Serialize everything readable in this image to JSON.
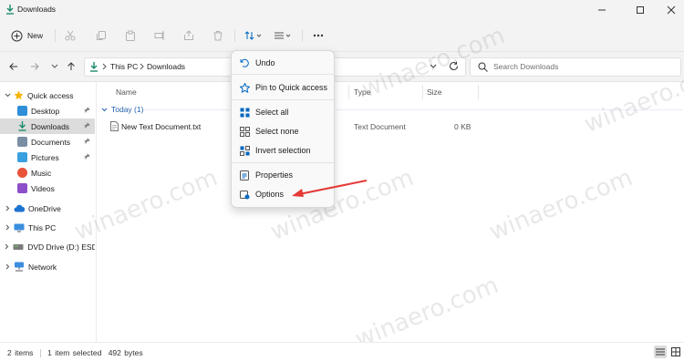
{
  "window": {
    "title": "Downloads"
  },
  "toolbar": {
    "new_label": "New",
    "icons": [
      "cut-icon",
      "copy-icon",
      "paste-icon",
      "rename-icon",
      "share-icon",
      "delete-icon",
      "sort-icon",
      "view-icon",
      "more-icon"
    ]
  },
  "address": {
    "crumbs": [
      "This PC",
      "Downloads"
    ],
    "search_placeholder": "Search Downloads"
  },
  "nav": {
    "items": [
      {
        "label": "Quick access",
        "icon": "star-icon"
      },
      {
        "label": "Desktop",
        "icon": "desktop-icon"
      },
      {
        "label": "Downloads",
        "icon": "downloads-icon"
      },
      {
        "label": "Documents",
        "icon": "documents-icon"
      },
      {
        "label": "Pictures",
        "icon": "pictures-icon"
      },
      {
        "label": "Music",
        "icon": "music-icon"
      },
      {
        "label": "Videos",
        "icon": "videos-icon"
      },
      {
        "label": "OneDrive",
        "icon": "cloud-icon"
      },
      {
        "label": "This PC",
        "icon": "computer-icon"
      },
      {
        "label": "DVD Drive (D:) ESD-I",
        "icon": "dvd-icon"
      },
      {
        "label": "Network",
        "icon": "network-icon"
      }
    ]
  },
  "files": {
    "columns": [
      "Name",
      "Type",
      "Size"
    ],
    "group": "Today (1)",
    "rows": [
      {
        "name": "New Text Document.txt",
        "type": "Text Document",
        "size": "0 KB"
      }
    ]
  },
  "menu": {
    "items": [
      "Undo",
      "Pin to Quick access",
      "Select all",
      "Select none",
      "Invert selection",
      "Properties",
      "Options"
    ]
  },
  "status": {
    "items_count": "2 items",
    "selection": "1 item selected",
    "size": "492 bytes"
  },
  "watermark": "winaero.com",
  "colors": {
    "accent": "#0067c0",
    "arrow": "#e53935",
    "folder": "#f7c652"
  }
}
